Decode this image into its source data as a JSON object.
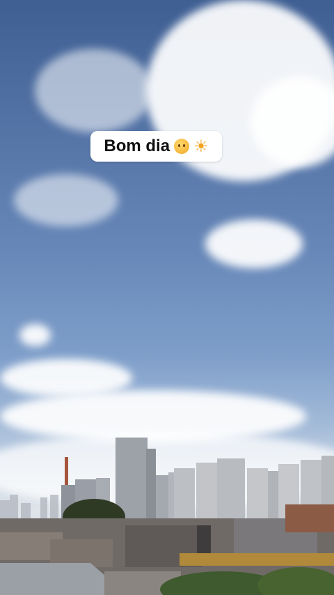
{
  "story": {
    "caption_text": "Bom dia",
    "caption_emojis": [
      "slightly-smiling-face-icon",
      "sun-icon"
    ],
    "colors": {
      "sky_top": "#3f5f93",
      "sky_mid": "#6787b8",
      "horizon": "#dfe4ea",
      "caption_bg": "#ffffff",
      "caption_text": "#111111"
    }
  }
}
